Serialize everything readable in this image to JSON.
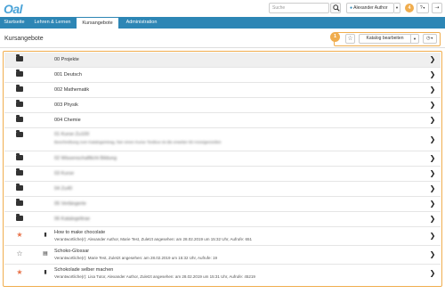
{
  "header": {
    "logo": "Oal",
    "search_placeholder": "Suche",
    "user_name": "Alexander Author",
    "notification_count": "4",
    "help_label": "?"
  },
  "nav": {
    "tabs": [
      {
        "label": "Startseite"
      },
      {
        "label": "Lehren & Lernen"
      },
      {
        "label": "Kursangebote"
      },
      {
        "label": "Administration"
      }
    ],
    "active_tab": "Kursangebote"
  },
  "page": {
    "title": "Kursangebote",
    "tools_badge": "1",
    "catalog_button": "Katalog bearbeiten"
  },
  "rows": [
    {
      "label": "00 Projekte"
    },
    {
      "label": "001 Deutsch"
    },
    {
      "label": "002 Mathematik"
    },
    {
      "label": "003 Physik"
    },
    {
      "label": "004 Chemie"
    },
    {
      "label": "01 Kurse Zu100",
      "sub": "Beschreibung zum Katalogeintrag, hier einen Kurse Textbox ist die erweiter 60 Anzeigenzeilen"
    },
    {
      "label": "02 Wissenschaftlicht Bildung"
    },
    {
      "label": "03 Kurse"
    },
    {
      "label": "04 Zu40"
    },
    {
      "label": "05 Verlängerte"
    },
    {
      "label": "06 Katalogeltrae"
    },
    {
      "label": "How to make chocolate",
      "sub": "Verantwortliche(r): Alexander Author, Marie Test, Zuletzt angesehen: am 28.02.2019 um 15:32 Uhr, Aufrufe: 651"
    },
    {
      "label": "Schoko-Glossar",
      "sub": "Verantwortliche(r): Marie Test, Zuletzt angesehen: am 28.02.2019 um 15:32 Uhr, Aufrufe: 19"
    },
    {
      "label": "Schokolade selber machen",
      "sub": "Verantwortliche(r): Lisa Tutor, Alexander Author, Zuletzt angesehen: am 28.02.2019 um 15:31 Uhr, Aufrufe: 45219"
    }
  ],
  "colors": {
    "brand": "#2d86b5",
    "accent": "#f0ad4e",
    "star_filled": "#e8734a"
  }
}
